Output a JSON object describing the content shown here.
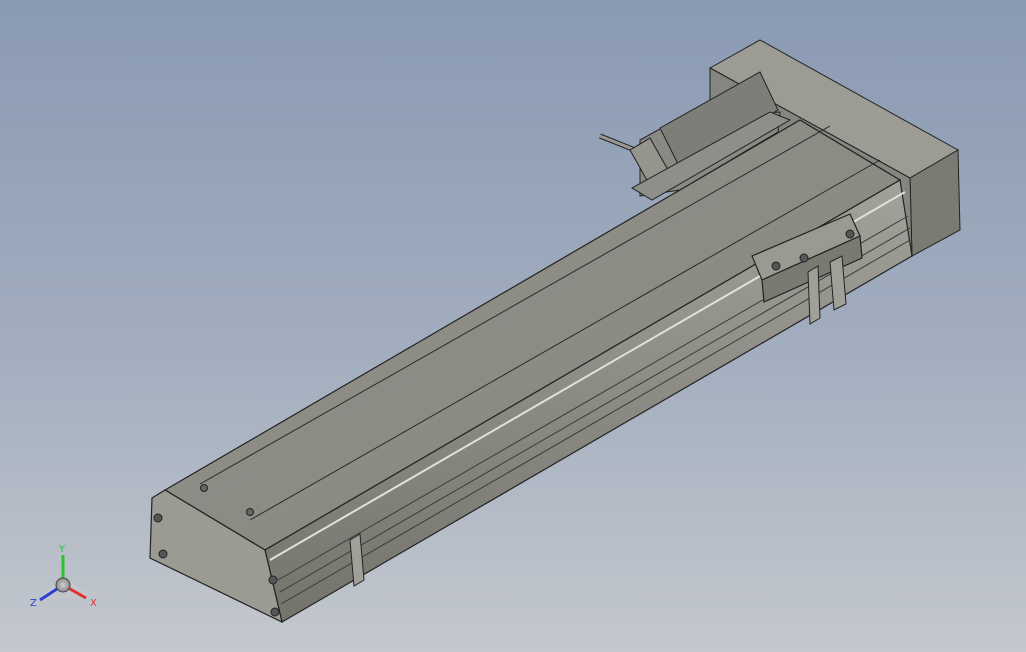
{
  "viewport": {
    "background_top": "#8a9ab3",
    "background_bottom": "#c4c8ce",
    "model_description_colors": {
      "body": "#8d8d86",
      "edge": "#222222"
    }
  },
  "triad": {
    "y_label": "Y",
    "z_label": "Z",
    "x_label": "X",
    "y_color": "#2bc22b",
    "z_color": "#2a3fd6",
    "x_color": "#e03030"
  }
}
